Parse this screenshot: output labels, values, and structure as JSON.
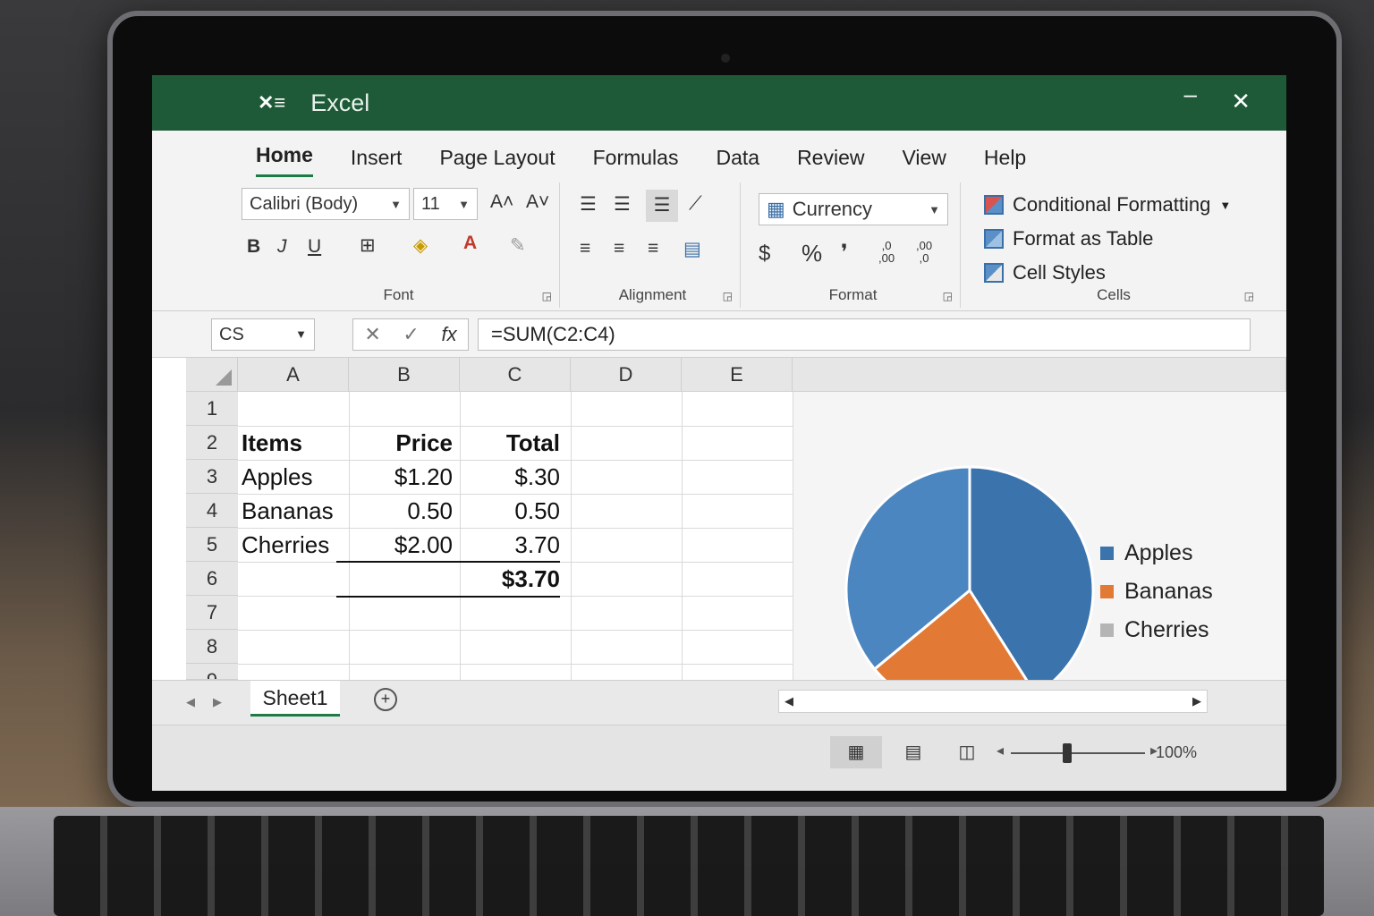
{
  "app": {
    "logo": "✕≡",
    "title": "Excel"
  },
  "window": {
    "minimize": "–",
    "close": "✕"
  },
  "menu": {
    "tabs": [
      "Home",
      "Insert",
      "Page Layout",
      "Formulas",
      "Data",
      "Review",
      "View",
      "Help"
    ],
    "active": "Home"
  },
  "ribbon": {
    "font": {
      "family": "Calibri (Body)",
      "size": "11",
      "grow": "A˄",
      "shrink": "A˅",
      "bold": "B",
      "italic": "J",
      "underline": "U",
      "group_label": "Font"
    },
    "alignment": {
      "group_label": "Alignment"
    },
    "number": {
      "format": "Currency",
      "currency_symbol": "$",
      "percent": "%",
      "comma": "❜",
      "increase_decimal": ",0\n,00",
      "decrease_decimal": ",00\n,0",
      "group_label": "Format"
    },
    "styles": {
      "conditional_formatting": "Conditional Formatting",
      "format_as_table": "Format as Table",
      "cell_styles": "Cell Styles",
      "group_label": "Cells"
    }
  },
  "formula_bar": {
    "name_box": "CS",
    "formula": "=SUM(C2:C4)"
  },
  "grid": {
    "columns": [
      "A",
      "B",
      "C",
      "D",
      "E"
    ],
    "rows": [
      "1",
      "2",
      "3",
      "4",
      "5",
      "6",
      "7",
      "8",
      "9"
    ],
    "cells": {
      "A2": "Items",
      "B2": "Price",
      "C2": "Total",
      "A3": "Apples",
      "B3": "$1.20",
      "C3": "$.30",
      "A4": "Bananas",
      "B4": "0.50",
      "C4": "0.50",
      "A5": "Cherries",
      "B5": "$2.00",
      "C5": "3.70",
      "C7": "$3.70"
    }
  },
  "chart_data": {
    "type": "pie",
    "categories": [
      "Apples",
      "Bananas",
      "Cherries"
    ],
    "values": [
      36,
      23,
      41
    ],
    "colors": [
      "#3b78b5",
      "#e07b34",
      "#a5a5a5"
    ],
    "slice_colors_rendered": [
      "#3b73ad",
      "#e27a36",
      "#4c86c0"
    ],
    "legend_position": "right"
  },
  "sheet_tabs": {
    "tabs": [
      "Sheet1"
    ],
    "add": "+"
  },
  "status": {
    "zoom": "100%"
  }
}
